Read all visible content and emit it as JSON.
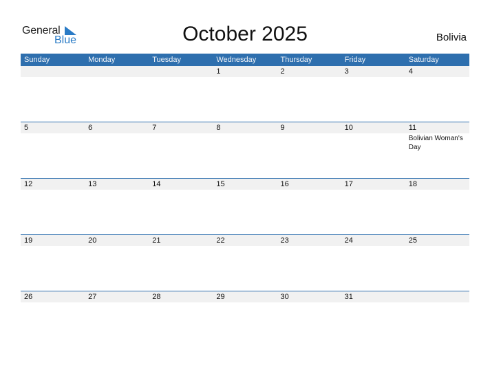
{
  "logo": {
    "general": "General",
    "blue": "Blue"
  },
  "title": "October 2025",
  "country": "Bolivia",
  "colors": {
    "header_bg": "#2e6fae",
    "accent": "#2a7bc6",
    "day_strip": "#f1f1f1"
  },
  "weekdays": [
    "Sunday",
    "Monday",
    "Tuesday",
    "Wednesday",
    "Thursday",
    "Friday",
    "Saturday"
  ],
  "weeks": [
    {
      "days": [
        {
          "n": "",
          "e": ""
        },
        {
          "n": "",
          "e": ""
        },
        {
          "n": "",
          "e": ""
        },
        {
          "n": "1",
          "e": ""
        },
        {
          "n": "2",
          "e": ""
        },
        {
          "n": "3",
          "e": ""
        },
        {
          "n": "4",
          "e": ""
        }
      ]
    },
    {
      "days": [
        {
          "n": "5",
          "e": ""
        },
        {
          "n": "6",
          "e": ""
        },
        {
          "n": "7",
          "e": ""
        },
        {
          "n": "8",
          "e": ""
        },
        {
          "n": "9",
          "e": ""
        },
        {
          "n": "10",
          "e": ""
        },
        {
          "n": "11",
          "e": "Bolivian Woman's Day"
        }
      ]
    },
    {
      "days": [
        {
          "n": "12",
          "e": ""
        },
        {
          "n": "13",
          "e": ""
        },
        {
          "n": "14",
          "e": ""
        },
        {
          "n": "15",
          "e": ""
        },
        {
          "n": "16",
          "e": ""
        },
        {
          "n": "17",
          "e": ""
        },
        {
          "n": "18",
          "e": ""
        }
      ]
    },
    {
      "days": [
        {
          "n": "19",
          "e": ""
        },
        {
          "n": "20",
          "e": ""
        },
        {
          "n": "21",
          "e": ""
        },
        {
          "n": "22",
          "e": ""
        },
        {
          "n": "23",
          "e": ""
        },
        {
          "n": "24",
          "e": ""
        },
        {
          "n": "25",
          "e": ""
        }
      ]
    },
    {
      "days": [
        {
          "n": "26",
          "e": ""
        },
        {
          "n": "27",
          "e": ""
        },
        {
          "n": "28",
          "e": ""
        },
        {
          "n": "29",
          "e": ""
        },
        {
          "n": "30",
          "e": ""
        },
        {
          "n": "31",
          "e": ""
        },
        {
          "n": "",
          "e": ""
        }
      ]
    }
  ]
}
